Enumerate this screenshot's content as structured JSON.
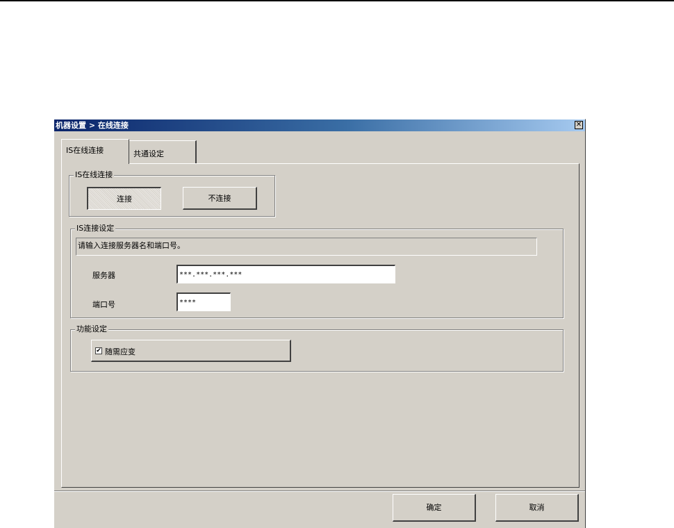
{
  "window": {
    "title": "机器设置 > 在线连接",
    "close_symbol": "✕"
  },
  "tabs": [
    {
      "label": "IS在线连接",
      "active": true
    },
    {
      "label": "共通设定",
      "active": false
    }
  ],
  "connection_group": {
    "legend": "IS在线连接",
    "connect_label": "连接",
    "disconnect_label": "不连接",
    "selected": "连接"
  },
  "settings_group": {
    "legend": "IS连接设定",
    "info_text": "请输入连接服务器名和端口号。",
    "server_label": "服务器",
    "server_value": "***.***.***.***",
    "port_label": "端口号",
    "port_value": "****"
  },
  "function_group": {
    "legend": "功能设定",
    "checkbox_label": "随需应变",
    "checkbox_checked": true,
    "check_mark": "✔"
  },
  "footer": {
    "ok_label": "确定",
    "cancel_label": "取消"
  }
}
